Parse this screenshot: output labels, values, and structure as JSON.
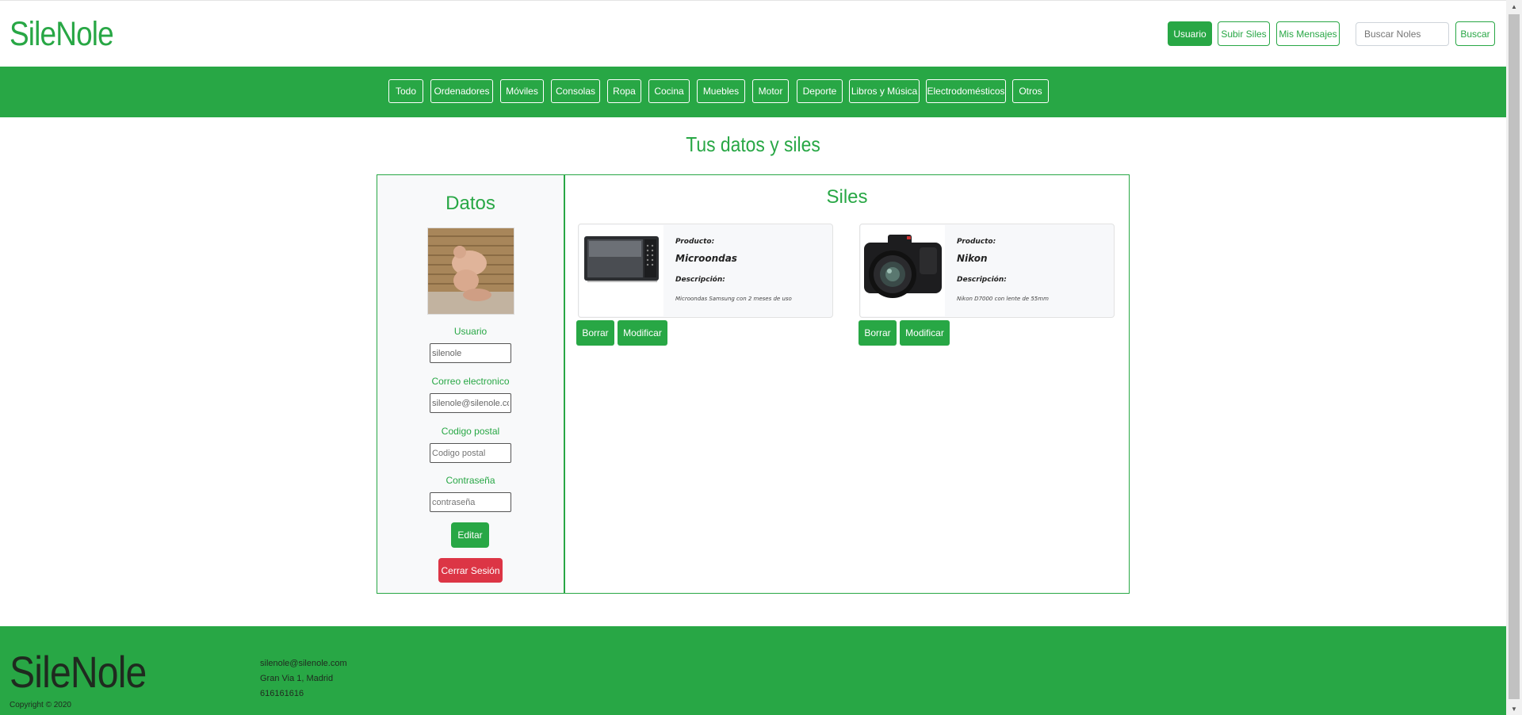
{
  "header": {
    "brand": "SileNole",
    "user_button": "Usuario",
    "upload_button": "Subir Siles",
    "messages_button": "Mis Mensajes",
    "search_placeholder": "Buscar Noles",
    "search_button": "Buscar"
  },
  "categories": [
    "Todo",
    "Ordenadores",
    "Móviles",
    "Consolas",
    "Ropa",
    "Cocina",
    "Muebles",
    "Motor",
    "Deporte",
    "Libros y Música",
    "Electrodomésticos",
    "Otros"
  ],
  "page_title": "Tus datos y siles",
  "profile": {
    "title": "Datos",
    "fields": [
      {
        "label": "Usuario",
        "value": "silenole",
        "placeholder": ""
      },
      {
        "label": "Correo electronico",
        "value": "silenole@silenole.com",
        "placeholder": ""
      },
      {
        "label": "Codigo postal",
        "value": "",
        "placeholder": "Codigo postal"
      },
      {
        "label": "Contraseña",
        "value": "",
        "placeholder": "contraseña"
      }
    ],
    "edit_button": "Editar",
    "logout_button": "Cerrar Sesión"
  },
  "siles": {
    "title": "Siles",
    "items": [
      {
        "product_label": "Producto:",
        "name": "Microondas",
        "description_label": "Descripción:",
        "description": "Microondas Samsung con 2 meses de uso",
        "delete_button": "Borrar",
        "edit_button": "Modificar",
        "image_icon": "microwave-image"
      },
      {
        "product_label": "Producto:",
        "name": "Nikon",
        "description_label": "Descripción:",
        "description": "Nikon D7000 con lente de 55mm",
        "delete_button": "Borrar",
        "edit_button": "Modificar",
        "image_icon": "camera-image"
      }
    ]
  },
  "footer": {
    "brand": "SileNole",
    "copyright": "Copyright © 2020",
    "email": "silenole@silenole.com",
    "address": "Gran Via 1, Madrid",
    "phone": "616161616"
  },
  "colors": {
    "primary": "#28a745",
    "danger": "#dc3545"
  }
}
